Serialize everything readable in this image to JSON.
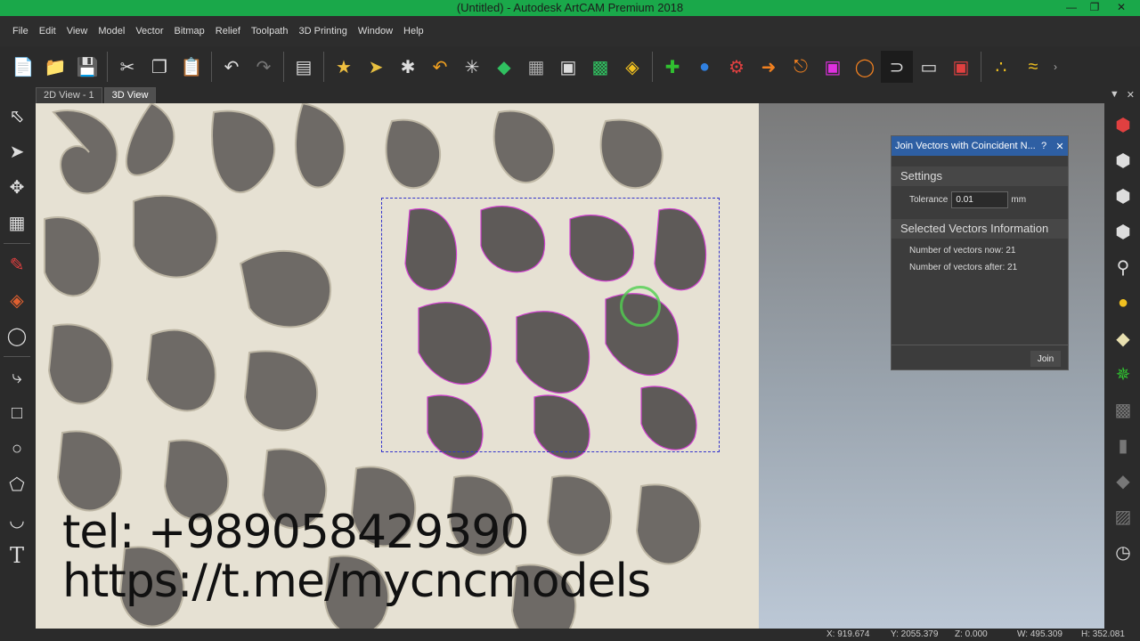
{
  "window": {
    "title": "(Untitled) - Autodesk ArtCAM Premium 2018"
  },
  "menu": [
    "File",
    "Edit",
    "View",
    "Model",
    "Vector",
    "Bitmap",
    "Relief",
    "Toolpath",
    "3D Printing",
    "Window",
    "Help"
  ],
  "tabs": [
    "2D View - 1",
    "3D View"
  ],
  "dialog": {
    "title": "Join Vectors with Coincident N...",
    "settings_header": "Settings",
    "tolerance_label": "Tolerance",
    "tolerance_value": "0.01",
    "tolerance_unit": "mm",
    "info_header": "Selected Vectors Information",
    "vectors_now": "Number of vectors now: 21",
    "vectors_after": "Number of vectors after: 21",
    "join_label": "Join"
  },
  "watermark": {
    "line1": "tel: +989058429390",
    "line2": "https://t.me/mycncmodels"
  },
  "status": {
    "x": "X: 919.674",
    "y": "Y: 2055.379",
    "z": "Z: 0.000",
    "w": "W: 495.309",
    "h": "H: 352.081"
  },
  "colors": {
    "titlebar": "#1aa84a",
    "selection": "#3333cc",
    "vector_outline": "#d040d0"
  },
  "icons": {
    "toolbar": [
      "new-file-icon",
      "open-folder-icon",
      "save-icon",
      "cut-icon",
      "copy-icon",
      "paste-icon",
      "undo-icon",
      "redo-icon",
      "notes-icon",
      "import-icon",
      "vector-icon",
      "trim-icon",
      "fillet-icon",
      "star-icon",
      "relief-icon",
      "layers-icon",
      "offset-icon",
      "group-icon",
      "weld-icon",
      "add-icon",
      "sphere-icon",
      "gear-icon",
      "mirror-icon",
      "node-icon",
      "select-node-icon",
      "shape-icon",
      "join-icon",
      "rounded-rect-icon",
      "transform-icon",
      "points-icon",
      "wave-icon"
    ],
    "left": [
      "select-icon",
      "node-edit-icon",
      "transform-icon",
      "grid-icon",
      "pencil-icon",
      "eraser-icon",
      "measure-icon",
      "polyline-icon",
      "rectangle-icon",
      "circle-icon",
      "polygon-icon",
      "arc-icon",
      "text-icon"
    ],
    "right": [
      "view-iso-icon",
      "view-top-icon",
      "view-front-icon",
      "view-side-icon",
      "zoom-icon",
      "light-icon",
      "layers-icon",
      "axes-icon",
      "relief-icon",
      "cylinder-icon",
      "block-icon",
      "model-icon",
      "clock-icon"
    ]
  }
}
